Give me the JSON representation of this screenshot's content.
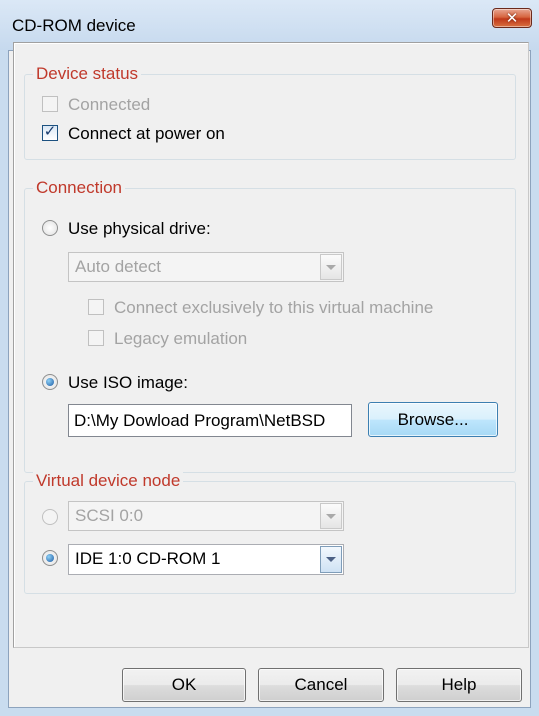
{
  "window": {
    "title": "CD-ROM device"
  },
  "device_status": {
    "group_label": "Device status",
    "connected": {
      "label": "Connected",
      "checked": false,
      "enabled": false
    },
    "connect_at_power_on": {
      "label": "Connect at power on",
      "checked": true,
      "enabled": true
    }
  },
  "connection": {
    "group_label": "Connection",
    "use_physical_drive": {
      "label": "Use physical drive:",
      "selected": false
    },
    "physical_drive_select": {
      "value": "Auto detect",
      "enabled": false
    },
    "connect_exclusively": {
      "label": "Connect exclusively to this virtual machine",
      "checked": false,
      "enabled": false
    },
    "legacy_emulation": {
      "label": "Legacy emulation",
      "checked": false,
      "enabled": false
    },
    "use_iso_image": {
      "label": "Use ISO image:",
      "selected": true
    },
    "iso_path": {
      "value": "D:\\My Dowload Program\\NetBSD"
    },
    "browse_label": "Browse..."
  },
  "virtual_device_node": {
    "group_label": "Virtual device node",
    "scsi": {
      "value": "SCSI 0:0",
      "selected": false,
      "enabled": false
    },
    "ide": {
      "value": "IDE 1:0  CD-ROM 1",
      "selected": true,
      "enabled": true
    }
  },
  "footer": {
    "ok_label": "OK",
    "cancel_label": "Cancel",
    "help_label": "Help"
  },
  "icons": {
    "close": "close-icon",
    "dropdown": "chevron-down-icon",
    "check": "checkmark-icon"
  }
}
